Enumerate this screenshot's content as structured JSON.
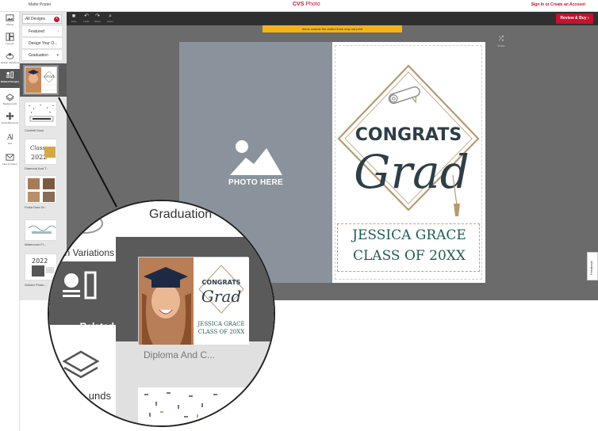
{
  "app": {
    "title": "Matte Poster",
    "brand": "CVS",
    "brand_suffix": " Photo",
    "signin": "Sign In or Create an Account"
  },
  "toolbar": {
    "tools": [
      {
        "icon": "save-icon",
        "label": "Save"
      },
      {
        "icon": "undo-icon",
        "label": "Undo"
      },
      {
        "icon": "redo-icon",
        "label": "Redo"
      },
      {
        "icon": "zoom-icon",
        "label": "Zoom"
      }
    ],
    "review_label": "Review & Buy  ›"
  },
  "rail": {
    "items": [
      {
        "icon": "photos-icon",
        "label": "Photos"
      },
      {
        "icon": "layouts-icon",
        "label": "Layouts"
      },
      {
        "icon": "design-variations-icon",
        "label": "Design Variations"
      },
      {
        "icon": "related-designs-icon",
        "label": "Related Designs"
      },
      {
        "icon": "backgrounds-icon",
        "label": "Backgrounds"
      },
      {
        "icon": "embellishments-icon",
        "label": "Embellishments"
      },
      {
        "icon": "text-icon",
        "label": "Text"
      },
      {
        "icon": "new-frame-icon",
        "label": "New & Frame"
      }
    ]
  },
  "panel": {
    "filter": "All Designs",
    "categories": [
      "Featured",
      "Design Your O...",
      "Graduation"
    ],
    "thumbs": [
      "Confetti Grad",
      "Diamond And T...",
      "Polka Dots Gr...",
      "Watercolor Fl...",
      "Golden Photo..."
    ]
  },
  "workspace": {
    "notice": "Items outside the dotted lines may not print",
    "shuffle_label": "Shuffle",
    "feedback": "Feedback"
  },
  "canvas": {
    "photo_placeholder": "PHOTO HERE",
    "congrats": "CONGRATS",
    "grad": "Grad",
    "name_line1": "JESSICA GRACE",
    "name_line2": "CLASS OF 20XX"
  },
  "magnifier": {
    "heading": "Graduation",
    "variations": "gn Variations",
    "related": "Related Designs",
    "thumb_congrats": "CONGRATS",
    "thumb_grad": "Grad",
    "thumb_name1": "JESSICA GRACE",
    "thumb_name2": "CLASS OF 20XX",
    "caption": "Diploma And C...",
    "backgrounds": "unds"
  },
  "colors": {
    "brand": "#c8102e",
    "accent_teal": "#1f5a56",
    "notice": "#f5b31a"
  }
}
